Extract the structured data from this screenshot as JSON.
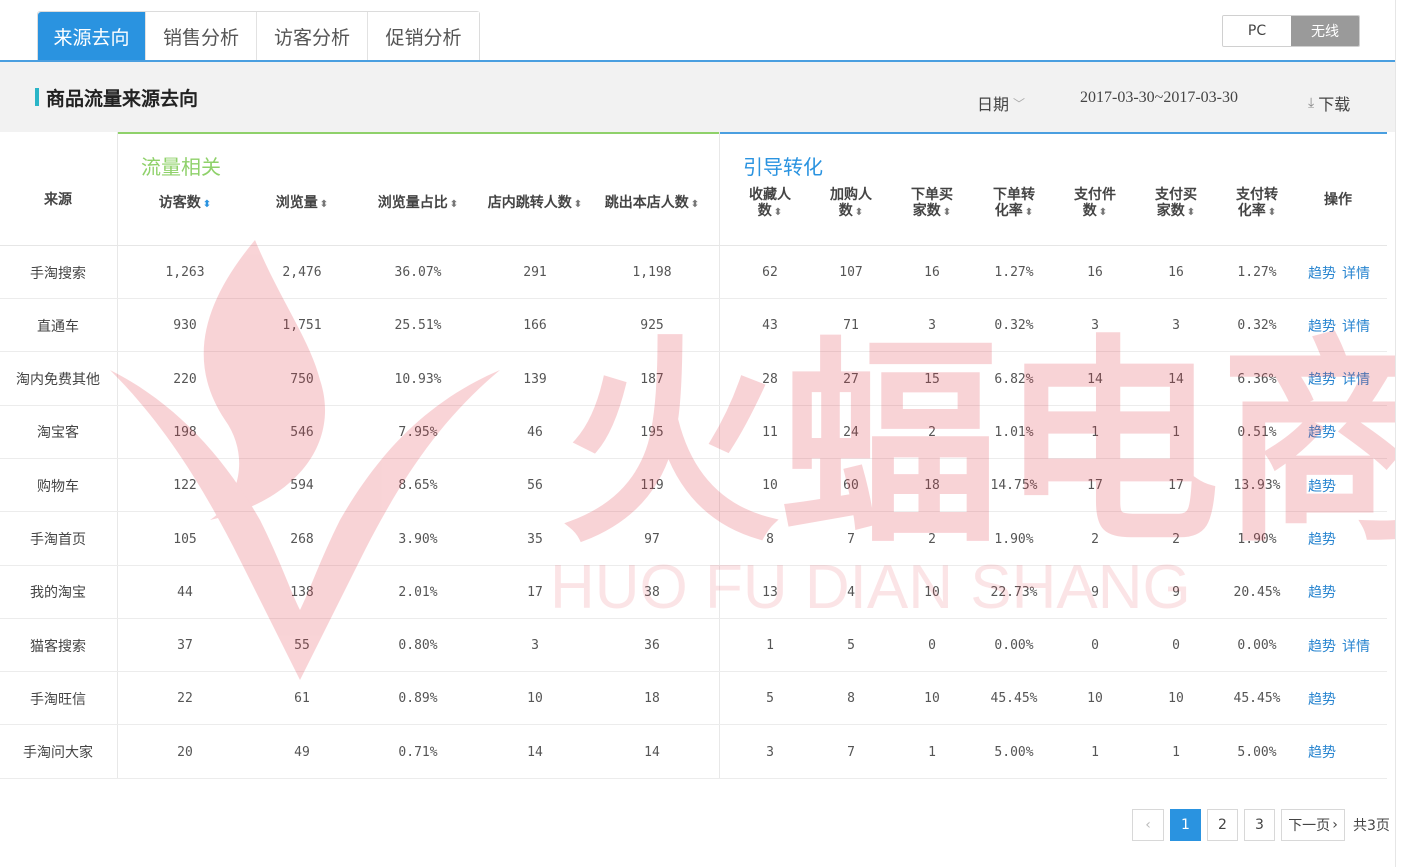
{
  "tabs": [
    {
      "label": "来源去向",
      "active": true
    },
    {
      "label": "销售分析",
      "active": false
    },
    {
      "label": "访客分析",
      "active": false
    },
    {
      "label": "促销分析",
      "active": false
    }
  ],
  "device_toggle": {
    "pc": "PC",
    "wireless": "无线",
    "selected": "无线"
  },
  "section": {
    "title": "商品流量来源去向",
    "date_label": "日期",
    "date_range": "2017-03-30~2017-03-30",
    "download": "下载"
  },
  "groups": {
    "traffic": "流量相关",
    "conversion": "引导转化"
  },
  "columns": {
    "source": "来源",
    "visitors": "访客数",
    "pageviews": "浏览量",
    "pv_share": "浏览量占比",
    "inner_jump": "店内跳转人数",
    "exit": "跳出本店人数",
    "favorites": [
      "收藏人",
      "数"
    ],
    "cart_add": [
      "加购人",
      "数"
    ],
    "order_buyers": [
      "下单买",
      "家数"
    ],
    "order_rate": [
      "下单转",
      "化率"
    ],
    "pay_items": [
      "支付件",
      "数"
    ],
    "pay_buyers": [
      "支付买",
      "家数"
    ],
    "pay_rate": [
      "支付转",
      "化率"
    ],
    "ops": "操作"
  },
  "rows": [
    {
      "source": "手淘搜索",
      "visitors": "1,263",
      "pageviews": "2,476",
      "pv_share": "36.07%",
      "inner_jump": "291",
      "exit": "1,198",
      "favorites": "62",
      "cart_add": "107",
      "order_buyers": "16",
      "order_rate": "1.27%",
      "pay_items": "16",
      "pay_buyers": "16",
      "pay_rate": "1.27%",
      "trend": "趋势",
      "detail": "详情"
    },
    {
      "source": "直通车",
      "visitors": "930",
      "pageviews": "1,751",
      "pv_share": "25.51%",
      "inner_jump": "166",
      "exit": "925",
      "favorites": "43",
      "cart_add": "71",
      "order_buyers": "3",
      "order_rate": "0.32%",
      "pay_items": "3",
      "pay_buyers": "3",
      "pay_rate": "0.32%",
      "trend": "趋势",
      "detail": "详情"
    },
    {
      "source": "淘内免费其他",
      "visitors": "220",
      "pageviews": "750",
      "pv_share": "10.93%",
      "inner_jump": "139",
      "exit": "187",
      "favorites": "28",
      "cart_add": "27",
      "order_buyers": "15",
      "order_rate": "6.82%",
      "pay_items": "14",
      "pay_buyers": "14",
      "pay_rate": "6.36%",
      "trend": "趋势",
      "detail": "详情"
    },
    {
      "source": "淘宝客",
      "visitors": "198",
      "pageviews": "546",
      "pv_share": "7.95%",
      "inner_jump": "46",
      "exit": "195",
      "favorites": "11",
      "cart_add": "24",
      "order_buyers": "2",
      "order_rate": "1.01%",
      "pay_items": "1",
      "pay_buyers": "1",
      "pay_rate": "0.51%",
      "trend": "趋势",
      "detail": ""
    },
    {
      "source": "购物车",
      "visitors": "122",
      "pageviews": "594",
      "pv_share": "8.65%",
      "inner_jump": "56",
      "exit": "119",
      "favorites": "10",
      "cart_add": "60",
      "order_buyers": "18",
      "order_rate": "14.75%",
      "pay_items": "17",
      "pay_buyers": "17",
      "pay_rate": "13.93%",
      "trend": "趋势",
      "detail": ""
    },
    {
      "source": "手淘首页",
      "visitors": "105",
      "pageviews": "268",
      "pv_share": "3.90%",
      "inner_jump": "35",
      "exit": "97",
      "favorites": "8",
      "cart_add": "7",
      "order_buyers": "2",
      "order_rate": "1.90%",
      "pay_items": "2",
      "pay_buyers": "2",
      "pay_rate": "1.90%",
      "trend": "趋势",
      "detail": ""
    },
    {
      "source": "我的淘宝",
      "visitors": "44",
      "pageviews": "138",
      "pv_share": "2.01%",
      "inner_jump": "17",
      "exit": "38",
      "favorites": "13",
      "cart_add": "4",
      "order_buyers": "10",
      "order_rate": "22.73%",
      "pay_items": "9",
      "pay_buyers": "9",
      "pay_rate": "20.45%",
      "trend": "趋势",
      "detail": ""
    },
    {
      "source": "猫客搜索",
      "visitors": "37",
      "pageviews": "55",
      "pv_share": "0.80%",
      "inner_jump": "3",
      "exit": "36",
      "favorites": "1",
      "cart_add": "5",
      "order_buyers": "0",
      "order_rate": "0.00%",
      "pay_items": "0",
      "pay_buyers": "0",
      "pay_rate": "0.00%",
      "trend": "趋势",
      "detail": "详情"
    },
    {
      "source": "手淘旺信",
      "visitors": "22",
      "pageviews": "61",
      "pv_share": "0.89%",
      "inner_jump": "10",
      "exit": "18",
      "favorites": "5",
      "cart_add": "8",
      "order_buyers": "10",
      "order_rate": "45.45%",
      "pay_items": "10",
      "pay_buyers": "10",
      "pay_rate": "45.45%",
      "trend": "趋势",
      "detail": ""
    },
    {
      "source": "手淘问大家",
      "visitors": "20",
      "pageviews": "49",
      "pv_share": "0.71%",
      "inner_jump": "14",
      "exit": "14",
      "favorites": "3",
      "cart_add": "7",
      "order_buyers": "1",
      "order_rate": "5.00%",
      "pay_items": "1",
      "pay_buyers": "1",
      "pay_rate": "5.00%",
      "trend": "趋势",
      "detail": ""
    }
  ],
  "pagination": {
    "pages": [
      "1",
      "2",
      "3"
    ],
    "current": "1",
    "next": "下一页",
    "total": "共3页"
  },
  "watermark": {
    "cn": "火蝠电商",
    "en": "HUO FU DIAN SHANG"
  },
  "colors": {
    "accent": "#2a93e0",
    "traffic_green": "#8fd16a",
    "watermark": "#f3c9cc"
  },
  "icons": {
    "sort": "sort-icon",
    "download": "download-icon",
    "chevron": "chevron-down-icon",
    "prev": "chevron-left-icon",
    "next": "chevron-right-icon"
  }
}
